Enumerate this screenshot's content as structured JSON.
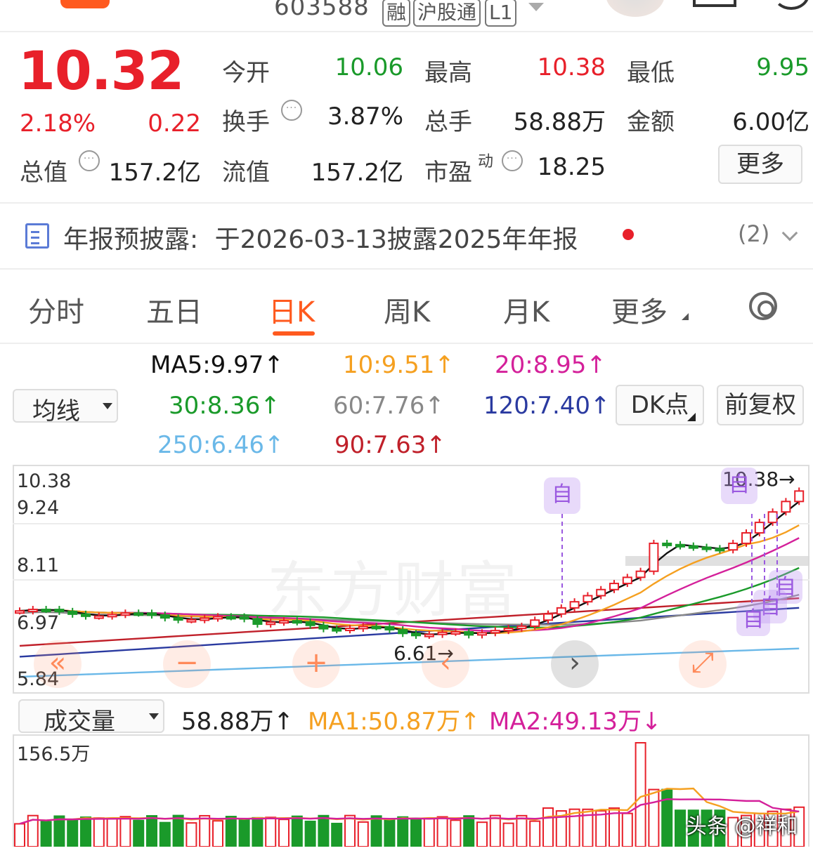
{
  "header": {
    "code": "603588",
    "tags": [
      "融",
      "沪股通",
      "L1"
    ]
  },
  "quote": {
    "price": "10.32",
    "change_pct": "2.18%",
    "change_amt": "0.22",
    "open_label": "今开",
    "open": "10.06",
    "high_label": "最高",
    "high": "10.38",
    "low_label": "最低",
    "low": "9.95",
    "turnover_label": "换手",
    "turnover": "3.87%",
    "volume_label": "总手",
    "volume": "58.88万",
    "amount_label": "金额",
    "amount": "6.00亿",
    "mktcap_label": "总值",
    "mktcap": "157.2亿",
    "float_label": "流值",
    "float_cap": "157.2亿",
    "pe_label": "市盈",
    "pe_sup": "动",
    "pe": "18.25",
    "more_label": "更多"
  },
  "notice": {
    "label": "年报预披露:",
    "text": "于2026-03-13披露2025年年报",
    "count": "(2)"
  },
  "tabs": [
    "分时",
    "五日",
    "日K",
    "周K",
    "月K",
    "更多"
  ],
  "ma": {
    "selector": "均线",
    "ma5": "MA5:9.97↑",
    "ma10": "10:9.51↑",
    "ma20": "20:8.95↑",
    "ma30": "30:8.36↑",
    "ma60": "60:7.76↑",
    "ma120": "120:7.40↑",
    "ma250": "250:6.46↑",
    "ma90": "90:7.63↑",
    "dk_label": "DK点",
    "fq_label": "前复权"
  },
  "kline": {
    "axis": [
      "10.38",
      "9.24",
      "8.11",
      "6.97",
      "5.84"
    ],
    "max_label": "10.38→",
    "min_label": "6.61→",
    "zi_label": "自",
    "watermark": "东方财富",
    "controls": [
      "«",
      "−",
      "+",
      "‹",
      "›",
      "⤢"
    ]
  },
  "volume": {
    "selector": "成交量",
    "current": "58.88万↑",
    "ma1": "MA1:50.87万↑",
    "ma2": "MA2:49.13万↓",
    "axis_max": "156.5万",
    "source": "头条 @祥和"
  },
  "colors": {
    "up": "#e8202a",
    "down": "#1a9a2a",
    "accent": "#ff5a1f",
    "ma5": "#111111",
    "ma10": "#f5a020",
    "ma20": "#d4209a",
    "ma30": "#1a9a2a",
    "ma60": "#888888",
    "ma120": "#2a3aa0",
    "ma250": "#6ab8e8",
    "ma90": "#c0202a"
  }
}
